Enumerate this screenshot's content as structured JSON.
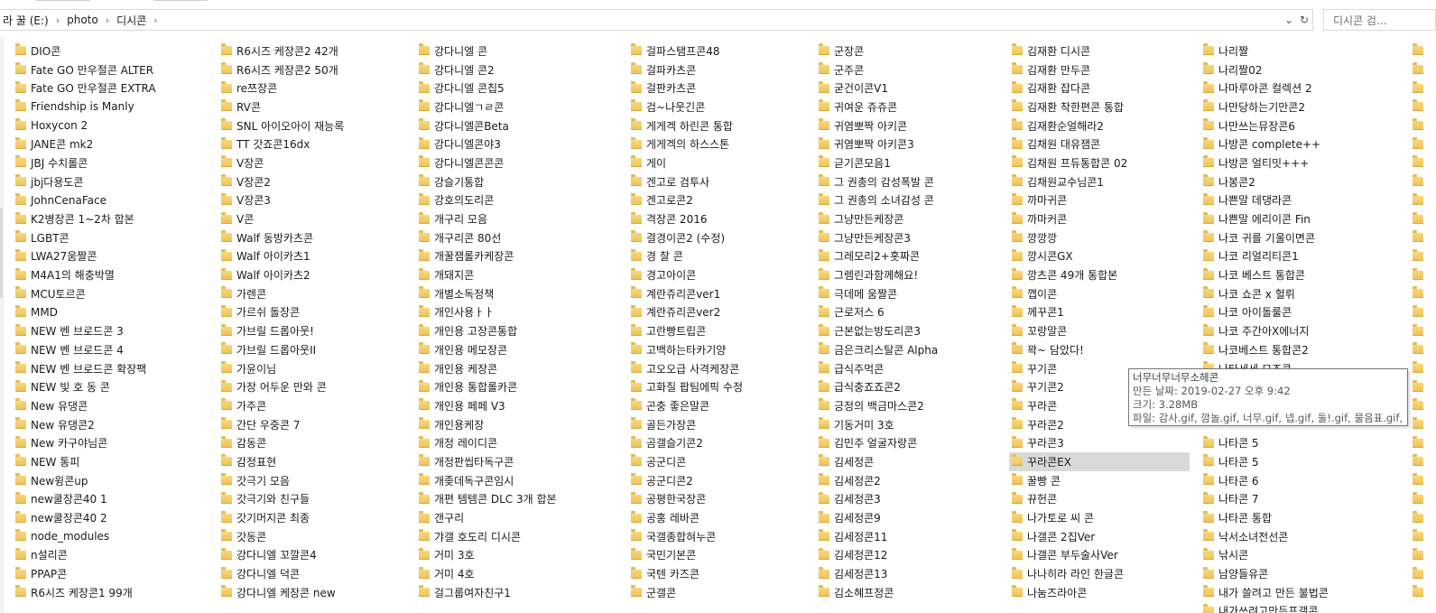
{
  "address_bar": {
    "crumbs": [
      "라 꿀 (E:)",
      "photo",
      "디시콘"
    ],
    "dropdown_icon": "chevron-down-icon",
    "refresh_icon": "refresh-icon"
  },
  "search": {
    "placeholder": "디시콘 검..."
  },
  "columns": [
    [
      "DIO콘",
      "Fate GO 만우절콘 ALTER",
      "Fate GO 만우절콘 EXTRA",
      "Friendship is Manly",
      "Hoxycon 2",
      "JANE콘 mk2",
      "JBJ 수치롤콘",
      "jbj다용도콘",
      "JohnCenaFace",
      "K2병장콘 1~2차 합본",
      "LGBT콘",
      "LWA27움짤콘",
      "M4A1의 해충박멸",
      "MCU토르콘",
      "MMD",
      "NEW 벤 브로드콘 3",
      "NEW 벤 브로드콘 4",
      "NEW 벤 브로드콘 확장팩",
      "NEW 빛 호 동 콘",
      "New 유댕콘",
      "New 유댕콘2",
      "New 카구야님콘",
      "NEW 통피",
      "New윙콘up",
      "new쿨장콘40 1",
      "new쿨장콘40 2",
      "node_modules",
      "n설리콘",
      "PPAP콘",
      "R6시즈 케장콘1 99개"
    ],
    [
      "R6시즈 케장콘2 42개",
      "R6시즈 케장콘2 50개",
      "re쯔장콘",
      "RV콘",
      "SNL 아이오아이 재능록",
      "TT 갓죠콘16dx",
      "V장콘",
      "V장콘2",
      "V장콘3",
      "V콘",
      "Walf 동방카츠콘",
      "Walf 아이카츠1",
      "Walf 아이카츠2",
      "가렌콘",
      "가르쉬 돌장콘",
      "가브릴 드롭아웃!",
      "가브릴 드롭아웃II",
      "가윤이님",
      "가장 어두운 만와 콘",
      "가주콘",
      "간단 우중콘 7",
      "감동콘",
      "감정표현",
      "갓극기 모음",
      "갓극기와 친구들",
      "갓기머지콘 최종",
      "갓동콘",
      "강다니엘 꼬깔콘4",
      "강다니엘 덕콘",
      "강다니엘 케장콘 new"
    ],
    [
      "강다니엘 콘",
      "강다니엘 콘2",
      "강다니엘 콘칩5",
      "강다니엘ㄱㄹ콘",
      "강다니엘콘Beta",
      "강다니엘콘야3",
      "강다니엘콘콘콘",
      "강슬기통합",
      "강호의도리콘",
      "개구리 모음",
      "개구리콘 80선",
      "개꿀잼롤카케장콘",
      "개돼지콘",
      "개별소독정책",
      "개인사용ㅏㅏ",
      "개인용 고장콘통합",
      "개인용 메모장콘",
      "개인용 케장콘",
      "개인용 통합롤카콘",
      "개인용 페페 V3",
      "개인용케장",
      "개정 레이디콘",
      "개정판씹타독구콘",
      "개좆데독구콘임시",
      "개편 템템콘 DLC 3개 합본",
      "갠구리",
      "갸갤 호도리 디시콘",
      "거미 3호",
      "거미 4호",
      "걸그룹여자친구1"
    ],
    [
      "걸파스탬프콘48",
      "걸파카츠콘",
      "걸판카츠콘",
      "검~나웃긴콘",
      "게게겍 하린콘 통합",
      "게게겍의 하스스톤",
      "게이",
      "겐고로 검투사",
      "겐고로콘2",
      "격장콘 2016",
      "결경이콘2 (수정)",
      "경 찰 콘",
      "경고아이콘",
      "계란쥬리콘ver1",
      "계란쥬리콘ver2",
      "고란빵트립콘",
      "고백하는타카기양",
      "고오오급 사격케장콘",
      "고화질 팝팀에픽 수정",
      "곤충 좋은말콘",
      "골든가장콘",
      "곰갤슬기콘2",
      "공군디콘",
      "공군디콘2",
      "공평한국장콘",
      "공홍 레바콘",
      "국갤종합혀누콘",
      "국민기본콘",
      "국텐 카즈콘",
      "군갤콘"
    ],
    [
      "군장콘",
      "군주콘",
      "굳건이콘V1",
      "귀여운 쥬쥬콘",
      "귀염뽀짝 아키콘",
      "귀염뽀짝 아키콘3",
      "귿기콘모음1",
      "그 권총의 감성폭발 콘",
      "그 권총의 소녀감성 콘",
      "그냥만든케장콘",
      "그냥만든케장콘3",
      "그레모리2+홋짜콘",
      "그렘린과함께해요!",
      "극데메 움짤콘",
      "근로저스 6",
      "근본없는방도리콘3",
      "금은크리스탈콘 Alpha",
      "급식주먹콘",
      "급식충죠죠콘2",
      "긍정의 백금마스콘2",
      "기동거미 3호",
      "김민주 얼굴자랑콘",
      "김세정콘",
      "김세정콘2",
      "김세정콘3",
      "김세정콘9",
      "김세정콘11",
      "김세정콘12",
      "김세정콘13",
      "김소혜프정콘"
    ],
    [
      "김재환 디시콘",
      "김재환 만두콘",
      "김재환 잡다콘",
      "김재환 착한편콘 통합",
      "김재환순얼해라2",
      "김채원 대유잼콘",
      "김채원 프듀통합콘 02",
      "김채원교수님콘1",
      "까마귀콘",
      "까마커콘",
      "깡깡깡",
      "깡시콘GX",
      "깡츠콘 49개 통합본",
      "깹이콘",
      "께꾸콘1",
      "꼬랑말콘",
      "꽉~ 담았다!",
      "꾸기콘",
      "꾸기콘2",
      "꾸라콘",
      "꾸라콘2",
      "꾸라콘3",
      "꾸라콘EX",
      "꿀빵 콘",
      "뀨헌콘",
      "나가토로 씨 콘",
      "나갤콘 2집Ver",
      "나갤콘 부두술사Ver",
      "나나히라 라인 한글콘",
      "나눔즈라아콘"
    ],
    [
      "나리짤",
      "나리짤02",
      "나마루아콘 컬렉션 2",
      "나만당하는기만콘2",
      "나만쓰는뮤장콘6",
      "나방콘 complete++",
      "나방콘 얼티밋+++",
      "나봉콘2",
      "나쁜말 데댕라콘",
      "나쁜말 에리이콘 Fin",
      "나코 귀를 기울이면콘",
      "나코 리얼리티콘1",
      "나코 베스트 통합콘",
      "나코 쇼콘 x 헐뤼",
      "나코 아이돌룰콘",
      "나코 주간아X에너지",
      "나코베스트 통합콘2",
      "나타세세 모조콘",
      "",
      "",
      "",
      "나타콘 5",
      "나타콘 5",
      "나타콘 6",
      "나타콘 7",
      "나타콘 통합",
      "낙서소녀전선콘",
      "낚시콘",
      "남양들유콘",
      "내가 쓸려고 만든 불법콘",
      "내가쓰려고만든프갤콘"
    ]
  ],
  "selected_item": "꾸라콘EX",
  "tooltip": {
    "title": "너무너무너무소헤콘",
    "date": "만든 날짜: 2019-02-27 오후 9:42",
    "size": "크기: 3.28MB",
    "files": "파일: 감사.gif, 깜놀.gif, 너무.gif, 넵.gif, 둘!.gif, 물음표.gif, ..."
  }
}
